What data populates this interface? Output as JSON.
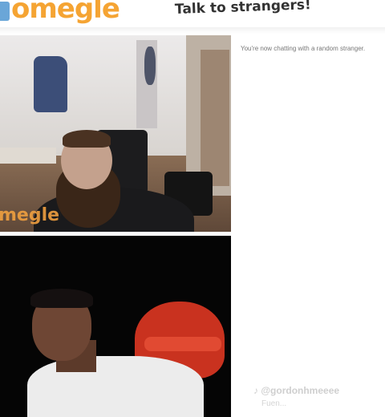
{
  "header": {
    "logo_text": "omegle",
    "tagline": "Talk to strangers!"
  },
  "stranger_video": {
    "watermark": "megle"
  },
  "chat": {
    "status_message": "You're now chatting with a random stranger."
  },
  "overlay": {
    "handle": "♪ @gordonhmeeee",
    "handle_secondary": "Fuen..."
  },
  "colors": {
    "brand_orange": "#f5a433",
    "logo_blue": "#6aa6d8"
  }
}
